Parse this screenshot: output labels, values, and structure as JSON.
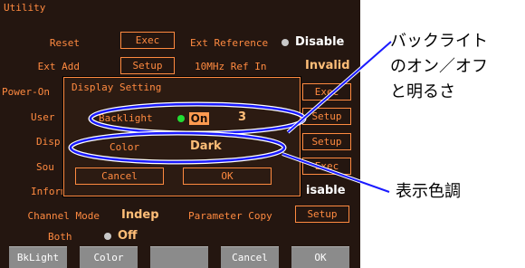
{
  "header": {
    "title": "Utility"
  },
  "rows": {
    "reset_label": "Reset",
    "reset_btn": "Exec",
    "ext_ref_label": "Ext Reference",
    "ext_ref_value": "Disable",
    "ext_add_label": "Ext Add",
    "ext_add_btn": "Setup",
    "ref_in_label": "10MHz Ref In",
    "ref_in_value": "Invalid",
    "power_on_label": "Power-On",
    "user_label": "User",
    "display_label": "Disp",
    "sound_label": "Sou",
    "inform_label": "Inform",
    "right_btn_1": "Exec",
    "right_btn_2": "Setup",
    "right_btn_3": "Setup",
    "right_btn_4": "Exec",
    "right_value_5": "isable",
    "channel_mode_label": "Channel Mode",
    "channel_mode_value": "Indep",
    "param_copy_label": "Parameter Copy",
    "param_copy_btn": "Setup",
    "both_label": "Both",
    "both_value": "Off"
  },
  "dialog": {
    "title": "Display Setting",
    "backlight_label": "Backlight",
    "backlight_state": "On",
    "backlight_level": "3",
    "color_label": "Color",
    "color_value": "Dark",
    "cancel_label": "Cancel",
    "ok_label": "OK"
  },
  "softkeys": [
    "BkLight",
    "Color",
    "",
    "Cancel",
    "OK"
  ],
  "annotations": {
    "backlight_line1": "バックライト",
    "backlight_line2": "のオン／オフ",
    "backlight_line3": "と明るさ",
    "color_tone": "表示色調"
  },
  "colors": {
    "screen_bg": "#241610",
    "text": "#ff8a40",
    "value": "#ffbe78",
    "led_green": "#22dd33",
    "led_gray": "#c8c8c8",
    "callout": "#1a1aff"
  }
}
